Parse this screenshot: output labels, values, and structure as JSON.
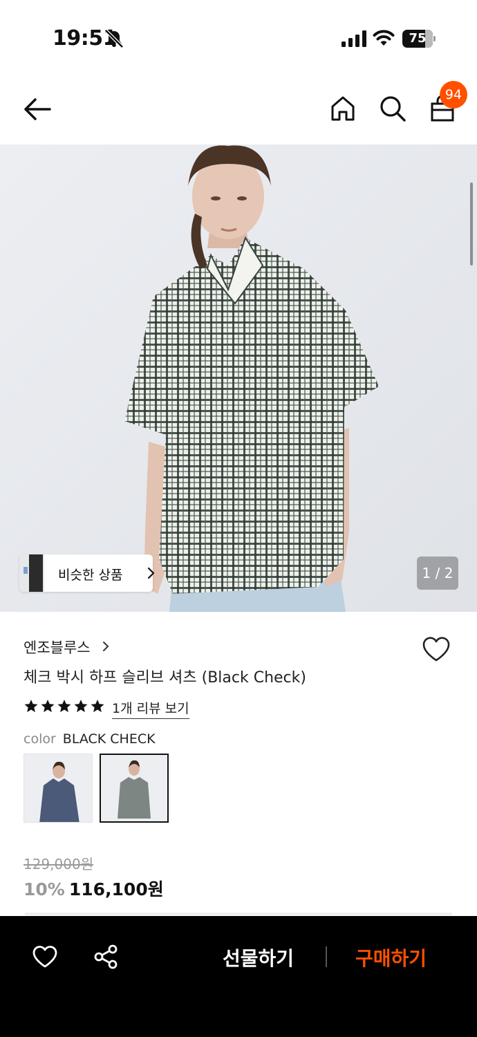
{
  "status_bar": {
    "time": "19:51",
    "battery": "75",
    "icons": [
      "bell-slash-icon",
      "cellular-signal-icon",
      "wifi-icon",
      "battery-icon"
    ]
  },
  "header": {
    "cart_count": "94",
    "icons": [
      "back-arrow-icon",
      "home-icon",
      "search-icon",
      "shopping-bag-icon"
    ]
  },
  "gallery": {
    "similar_label": "비슷한 상품",
    "pager": "1 / 2"
  },
  "product": {
    "brand": "엔조블루스",
    "name": "체크 박시 하프 슬리브 셔츠 (Black Check)",
    "rating": 5,
    "review_link": "1개 리뷰 보기",
    "color_label": "color",
    "color_value": "BLACK CHECK",
    "original_price": "129,000원",
    "discount": "10%",
    "final_price": "116,100원"
  },
  "bottom_bar": {
    "gift_label": "선물하기",
    "buy_label": "구매하기",
    "icons": [
      "heart-icon",
      "share-icon"
    ]
  },
  "colors": {
    "accent": "#ff5000",
    "bar": "#000000"
  }
}
